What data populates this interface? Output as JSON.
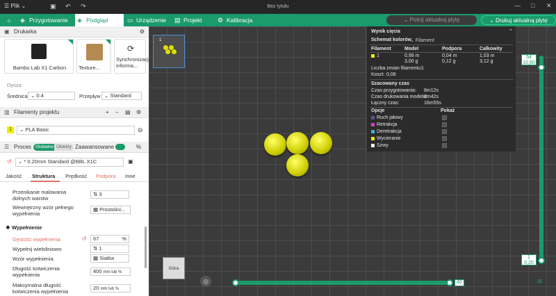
{
  "app": {
    "menu_label": "Plik",
    "title": "Bez tytułu"
  },
  "nav": {
    "tabs": [
      {
        "label": "Przygotowanie"
      },
      {
        "label": "Podgląd"
      },
      {
        "label": "Urządzenie"
      },
      {
        "label": "Projekt"
      },
      {
        "label": "Kalibracja"
      }
    ],
    "refresh_plate": "Potnij aktualną płytę",
    "print_plate": "Drukuj aktualną płytę"
  },
  "printer": {
    "section": "Drukarka",
    "printer_name": "Bambu Lab X1 Carbon",
    "plate_label": "Texture...",
    "sync_label": "Synchronizacja informa...",
    "nozzle_title": "Dysza",
    "diameter_label": "Średnica",
    "diameter_value": "0.4",
    "flow_label": "Przepływ",
    "flow_value": "Standard"
  },
  "filaments": {
    "section": "Filamenty projektu",
    "items": [
      {
        "index": "1",
        "name": "PLA Basic"
      }
    ]
  },
  "process": {
    "section": "Proces",
    "toggle_global": "Globalne",
    "toggle_objects": "Obiekty",
    "advanced": "Zaawansowane",
    "profile": "* 0.20mm Standard @BBL X1C",
    "tabs": [
      "Jakość",
      "Struktura",
      "Prędkość",
      "Podpora",
      "Inne"
    ],
    "rows": [
      {
        "label": "Przenikanie malowania dolnych warstw",
        "value": "3"
      },
      {
        "label": "Wewnętrzny wzór pełnego wypełnienia",
        "value": "Prostolini..."
      }
    ],
    "infill_section": "Wypełnienie",
    "infill_rows": [
      {
        "label": "Gęstość wypełnienia",
        "value": "67",
        "unit": "%"
      },
      {
        "label": "Wypełnij wieloliniowo",
        "value": "1"
      },
      {
        "label": "Wzór wypełnienia",
        "value": "Siatka"
      },
      {
        "label": "Długość kotwiczenia wypełnienia",
        "value": "400",
        "unit": "mm lub %"
      },
      {
        "label": "Maksymalna długość kotwiczenia wypełnienia",
        "value": "20",
        "unit": "mm lub %"
      }
    ]
  },
  "view": {
    "cube_label": "Góra"
  },
  "result": {
    "title": "Wynik cięcia",
    "scheme_label": "Schemat kolorów",
    "scheme_value": "Filament",
    "headers": [
      "Filament",
      "Model",
      "Podpora",
      "Całkowity"
    ],
    "row": {
      "index": "1",
      "model": "0,99 m",
      "model_g": "3,00 g",
      "support": "0,04 m",
      "support_g": "0,12 g",
      "total": "1,03 m",
      "total_g": "3,12 g"
    },
    "changes_label": "Liczba zmian filamentu:",
    "changes_value": "1",
    "cost_label": "Koszt:",
    "cost_value": "0,08",
    "time_title": "Szacowany czas",
    "prep_label": "Czas przygotowania:",
    "prep_value": "8m12s",
    "model_label": "Czas drukowania modelu:",
    "model_value": "8m42s",
    "total_label": "Łączny czas:",
    "total_value": "16m55s",
    "options_label": "Opcje",
    "show_label": "Pokaż",
    "options": [
      {
        "name": "Ruch jałowy",
        "color": "#555599"
      },
      {
        "name": "Retrakcja",
        "color": "#cc44cc"
      },
      {
        "name": "Deretrakcja",
        "color": "#44aadd"
      },
      {
        "name": "Wycieranie",
        "color": "#eeee00"
      },
      {
        "name": "Szwy",
        "color": "#eeeeee"
      }
    ]
  },
  "slider": {
    "top_layer": "54",
    "top_height": "10,80",
    "bottom_layer": "1",
    "bottom_height": "0,20",
    "h_value": "40"
  }
}
